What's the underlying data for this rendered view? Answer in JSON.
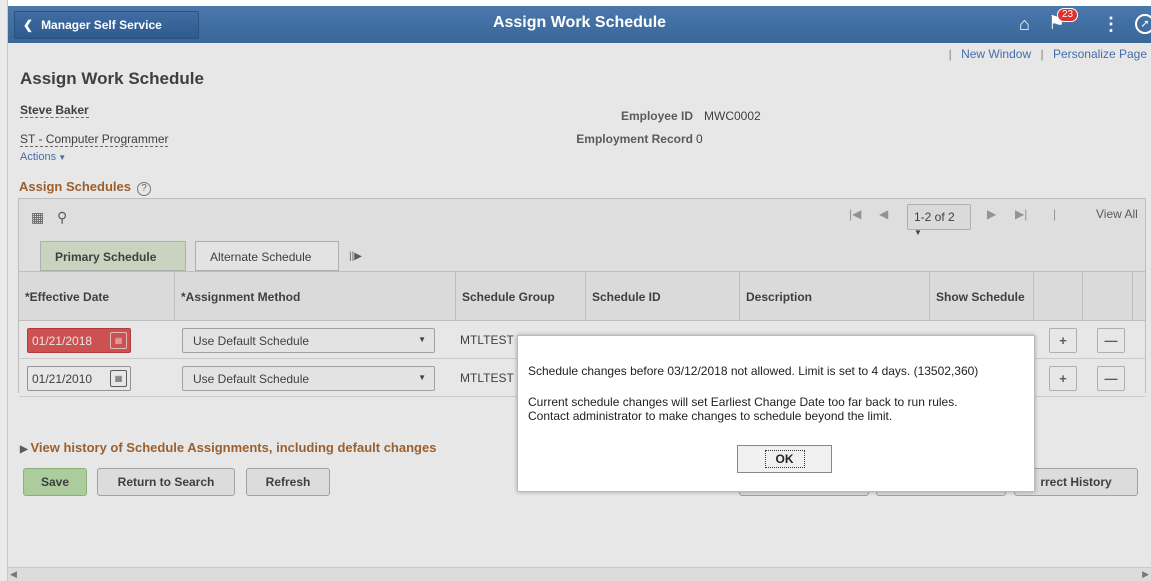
{
  "banner": {
    "back_label": "Manager Self Service",
    "title": "Assign Work Schedule",
    "notification_count": "23"
  },
  "toplinks": {
    "new_window": "New Window",
    "personalize": "Personalize Page"
  },
  "page": {
    "title": "Assign Work Schedule",
    "employee_name": "Steve Baker",
    "job_title": "ST - Computer Programmer",
    "actions": "Actions",
    "employee_id_label": "Employee ID",
    "employee_id": "MWC0002",
    "employment_record_label": "Employment Record",
    "employment_record": "0"
  },
  "section": {
    "title": "Assign Schedules",
    "pager_range": "1-2 of 2",
    "view_all": "View All",
    "tabs": [
      "Primary Schedule",
      "Alternate Schedule"
    ],
    "columns": [
      "*Effective Date",
      "*Assignment Method",
      "Schedule Group",
      "Schedule ID",
      "Description",
      "Show Schedule"
    ],
    "rows": [
      {
        "effective_date": "01/21/2018",
        "method": "Use Default Schedule",
        "group": "MTLTEST"
      },
      {
        "effective_date": "01/21/2010",
        "method": "Use Default Schedule",
        "group": "MTLTEST"
      }
    ],
    "history_link": "View history of Schedule Assignments, including default changes"
  },
  "buttons": {
    "save": "Save",
    "return": "Return to Search",
    "refresh": "Refresh",
    "correct_history": "rrect History"
  },
  "modal": {
    "line1": "Schedule changes before 03/12/2018  not allowed. Limit is set to 4 days. (13502,360)",
    "line2": "Current schedule changes will set Earliest Change Date too far back to run rules.",
    "line3": "Contact administrator to make changes to schedule beyond the limit.",
    "ok": "OK"
  }
}
